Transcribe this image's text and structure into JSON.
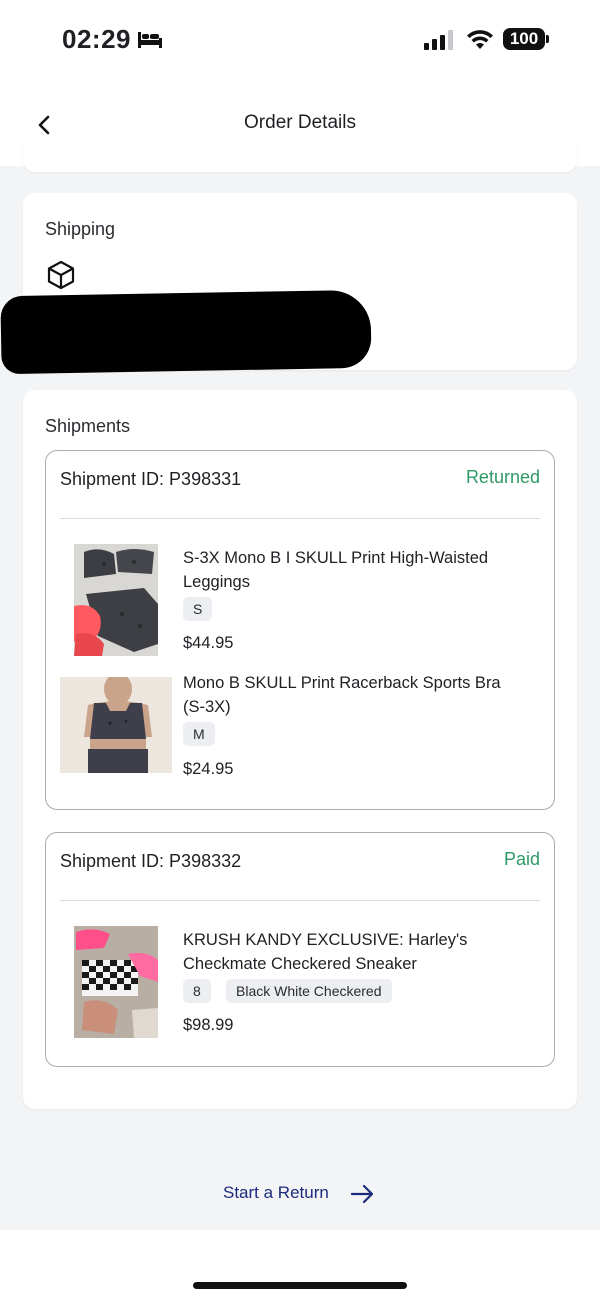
{
  "status_bar": {
    "time": "02:29",
    "battery": "100",
    "icons": [
      "bed-icon",
      "signal-icon",
      "wifi-icon",
      "battery-icon"
    ]
  },
  "header": {
    "title": "Order Details",
    "back_icon": "chevron-left-icon"
  },
  "shipping": {
    "title": "Shipping",
    "icon": "box-icon"
  },
  "shipments": {
    "title": "Shipments",
    "list": [
      {
        "id_label": "Shipment ID: P398331",
        "status": "Returned",
        "status_color": "#2f9966",
        "items": [
          {
            "name": "S-3X Mono B I SKULL Print High-Waisted Leggings",
            "tags": [
              "S"
            ],
            "price": "$44.95"
          },
          {
            "name": "Mono B SKULL Print Racerback Sports Bra (S-3X)",
            "tags": [
              "M"
            ],
            "price": "$24.95"
          }
        ]
      },
      {
        "id_label": "Shipment ID: P398332",
        "status": "Paid",
        "status_color": "#2f9966",
        "items": [
          {
            "name": "KRUSH KANDY EXCLUSIVE: Harley's Checkmate Checkered Sneaker",
            "tags": [
              "8",
              "Black White Checkered"
            ],
            "price": "$98.99"
          }
        ]
      }
    ]
  },
  "actions": {
    "start_return": "Start a Return",
    "arrow_icon": "arrow-right-icon"
  },
  "colors": {
    "accent_link": "#1b2a7a",
    "status_green": "#2f9966",
    "background": "#f3f4f6"
  }
}
